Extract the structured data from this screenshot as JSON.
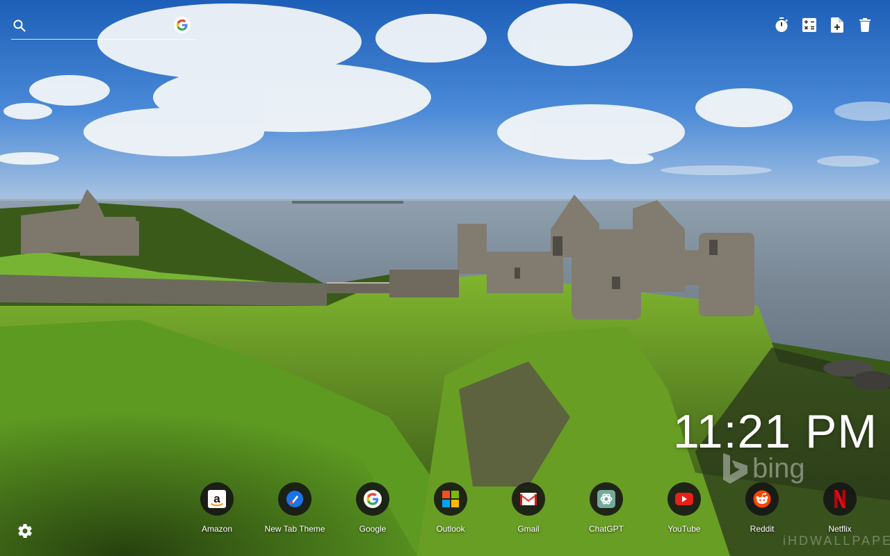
{
  "search": {
    "placeholder": "",
    "engine_icon": "google-g-icon"
  },
  "toolbar": [
    {
      "icon": "timer-icon"
    },
    {
      "icon": "calculator-icon"
    },
    {
      "icon": "add-note-icon"
    },
    {
      "icon": "trash-icon"
    }
  ],
  "clock": {
    "time": "11:21 PM"
  },
  "wallpaper": {
    "provider": "bing",
    "watermark": "iHDWALLPAPERS"
  },
  "shortcuts": [
    {
      "label": "Amazon",
      "icon": "amazon-icon"
    },
    {
      "label": "New Tab Theme",
      "icon": "new-tab-theme-icon"
    },
    {
      "label": "Google",
      "icon": "google-icon"
    },
    {
      "label": "Outlook",
      "icon": "outlook-icon"
    },
    {
      "label": "Gmail",
      "icon": "gmail-icon"
    },
    {
      "label": "ChatGPT",
      "icon": "chatgpt-icon"
    },
    {
      "label": "YouTube",
      "icon": "youtube-icon"
    },
    {
      "label": "Reddit",
      "icon": "reddit-icon"
    },
    {
      "label": "Netflix",
      "icon": "netflix-icon"
    }
  ],
  "settings": {
    "icon": "gear-icon"
  },
  "colors": {
    "sky_top": "#1d5fb8",
    "sea": "#7d8c9a",
    "grass": "#6fa52a",
    "youtube": "#e62117",
    "netflix": "#e50914",
    "reddit": "#ff4500"
  }
}
